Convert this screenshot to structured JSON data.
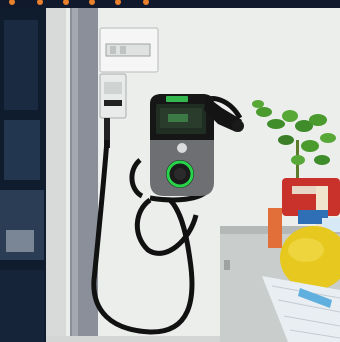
{
  "scene": {
    "subject": "ev-charger",
    "colors": {
      "wall": "#eceeec",
      "window": "#0e1c2e",
      "frame": "#8a8f99",
      "charger_body": "#6d6f72",
      "charger_face": "#161616",
      "ring": "#28d34a",
      "screen_glow": "#3bd35a",
      "cable": "#111111",
      "cabinet": "#c9cdcc",
      "plant": "#3f8c2b",
      "sponge": "#e6c81e",
      "basket": "#e9eef2",
      "red_bag": "#c8322b"
    }
  }
}
